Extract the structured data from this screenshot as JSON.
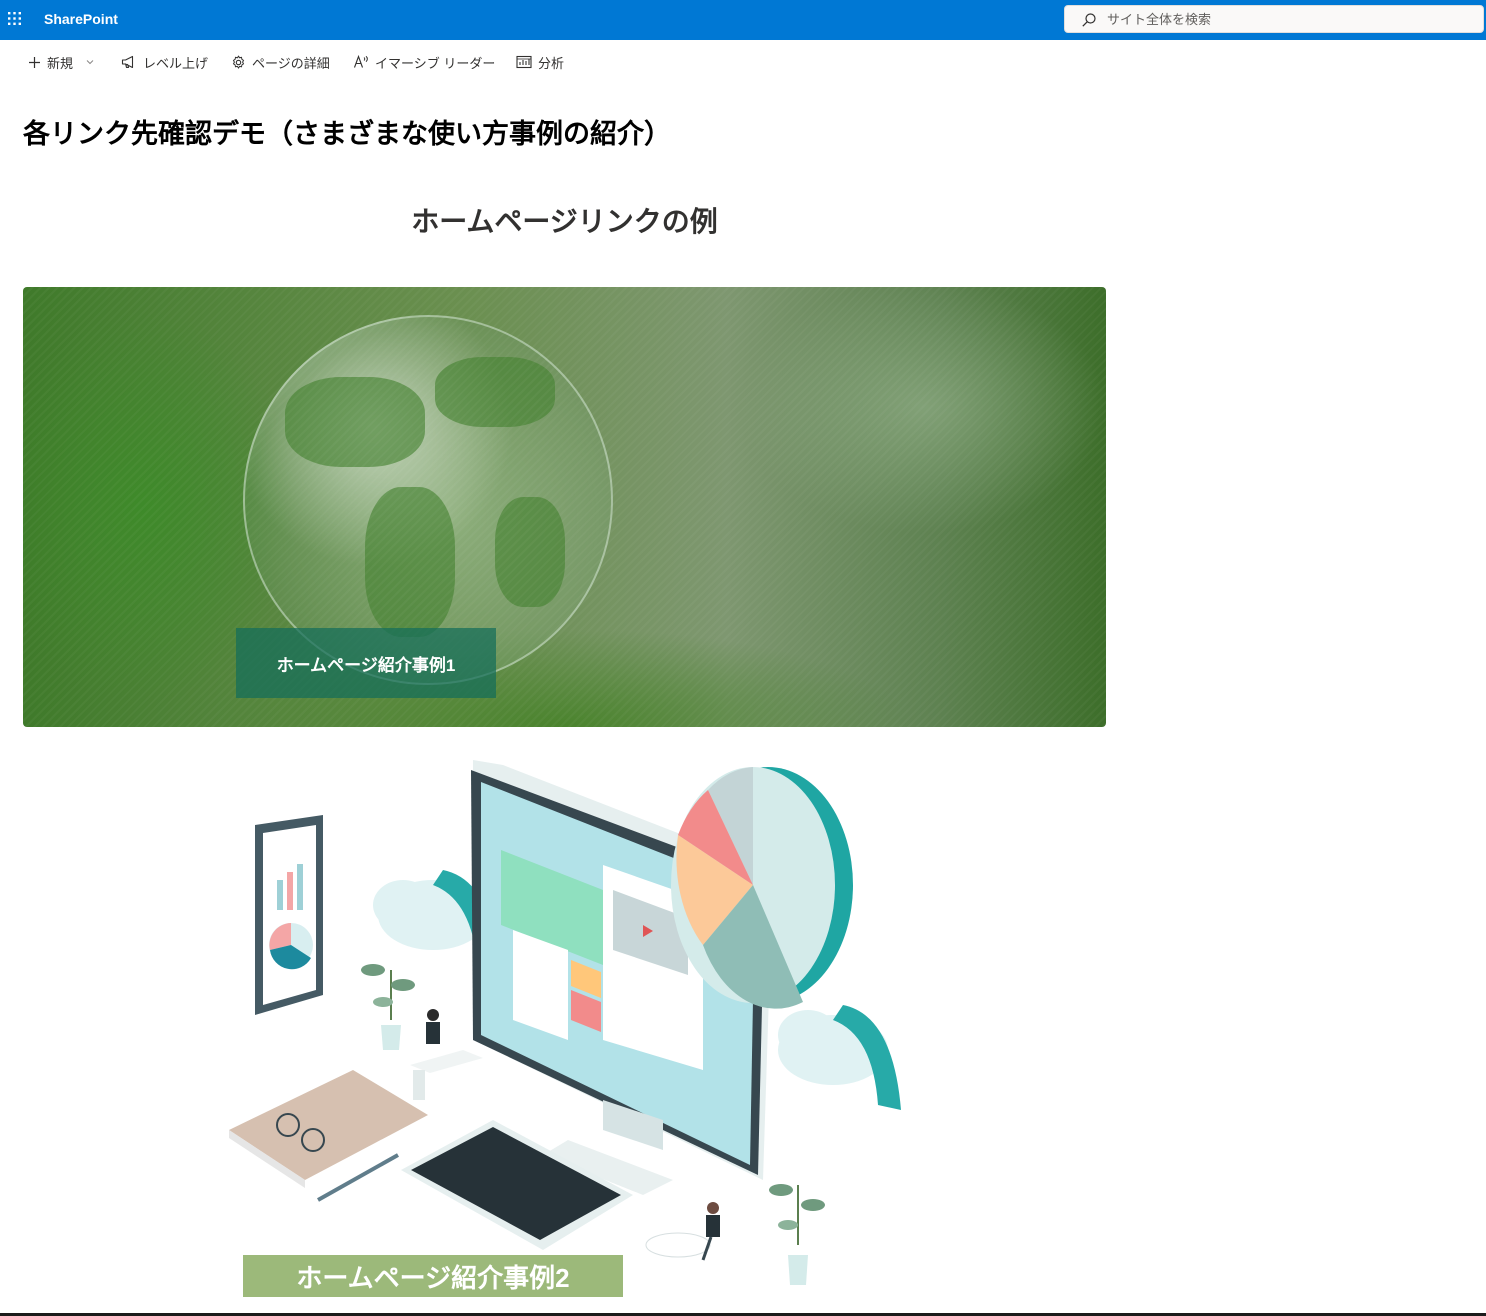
{
  "suite": {
    "app_name": "SharePoint",
    "search_placeholder": "サイト全体を検索"
  },
  "commands": [
    {
      "label": "新規",
      "icon": "plus-icon"
    },
    {
      "label": "レベル上げ",
      "icon": "megaphone-icon"
    },
    {
      "label": "ページの詳細",
      "icon": "gear-icon"
    },
    {
      "label": "イマーシブ リーダー",
      "icon": "immersive-reader-icon"
    },
    {
      "label": "分析",
      "icon": "analytics-icon"
    }
  ],
  "page": {
    "title": "各リンク先確認デモ（さまざまな使い方事例の紹介）",
    "section_heading": "ホームページリンクの例"
  },
  "cards": [
    {
      "label": "ホームページ紹介事例1",
      "image": "globe-on-moss-photo"
    },
    {
      "label": "ホームページ紹介事例2",
      "image": "isometric-computer-illustration"
    }
  ],
  "colors": {
    "suite_bar": "#0078d4",
    "card1_button": "#146e5a",
    "card2_button": "#9cb97a"
  }
}
